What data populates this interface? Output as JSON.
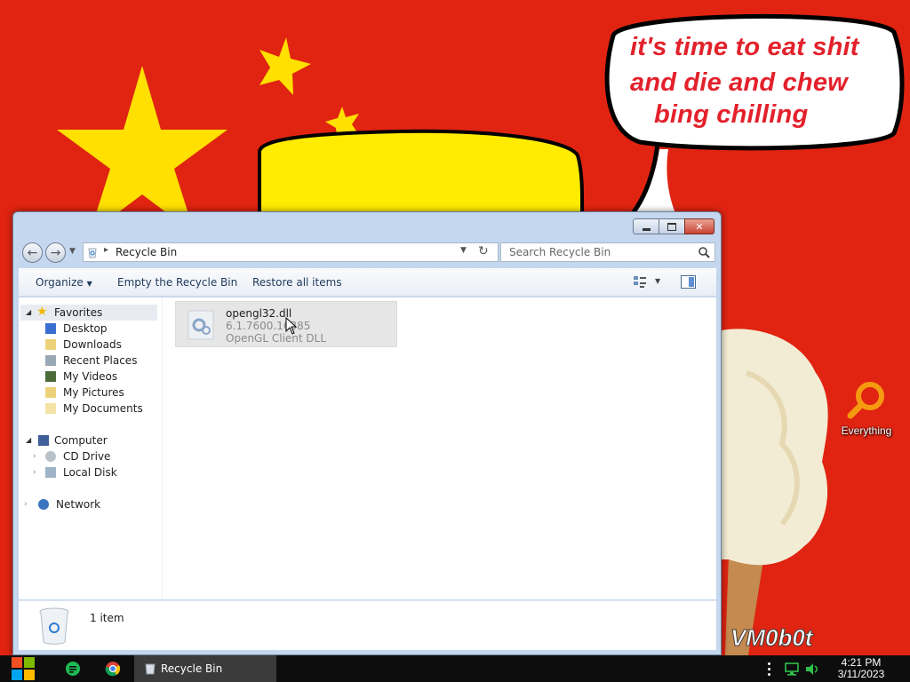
{
  "desktop": {
    "speech_bubble_lines": [
      "it's time to eat shit",
      "and die and chew",
      "bing chilling"
    ],
    "watermark": "VM0b0t",
    "icons": [
      {
        "label": "Everything",
        "icon": "search-magnifier-icon"
      }
    ]
  },
  "window": {
    "controls": {
      "minimize": "minimize-icon",
      "maximize": "maximize-icon",
      "close": "close-icon"
    },
    "address": {
      "breadcrumb": "Recycle Bin",
      "icon": "recycle-bin-icon"
    },
    "search": {
      "placeholder": "Search Recycle Bin"
    },
    "toolbar": {
      "organize": "Organize",
      "empty": "Empty the Recycle Bin",
      "restore": "Restore all items"
    },
    "navigation": {
      "favorites": {
        "label": "Favorites",
        "items": [
          "Desktop",
          "Downloads",
          "Recent Places",
          "My Videos",
          "My Pictures",
          "My Documents"
        ]
      },
      "computer": {
        "label": "Computer",
        "items": [
          "CD Drive",
          "Local Disk"
        ]
      },
      "network": {
        "label": "Network"
      }
    },
    "files": [
      {
        "name": "opengl32.dll",
        "version": "6.1.7600.16385",
        "description": "OpenGL Client DLL",
        "icon": "dll-file-icon"
      }
    ],
    "details": {
      "count": "1 item",
      "icon": "recycle-bin-icon"
    }
  },
  "taskbar": {
    "start_icon": "windows-logo-icon",
    "pinned": [
      "app-icon",
      "chrome-icon"
    ],
    "active_task": "Recycle Bin",
    "tray": {
      "time": "4:21 PM",
      "date": "3/11/2023"
    }
  },
  "colors": {
    "flag_red": "#e02411",
    "star_yellow": "#ffe000",
    "toolbar_text": "#1e395b"
  }
}
